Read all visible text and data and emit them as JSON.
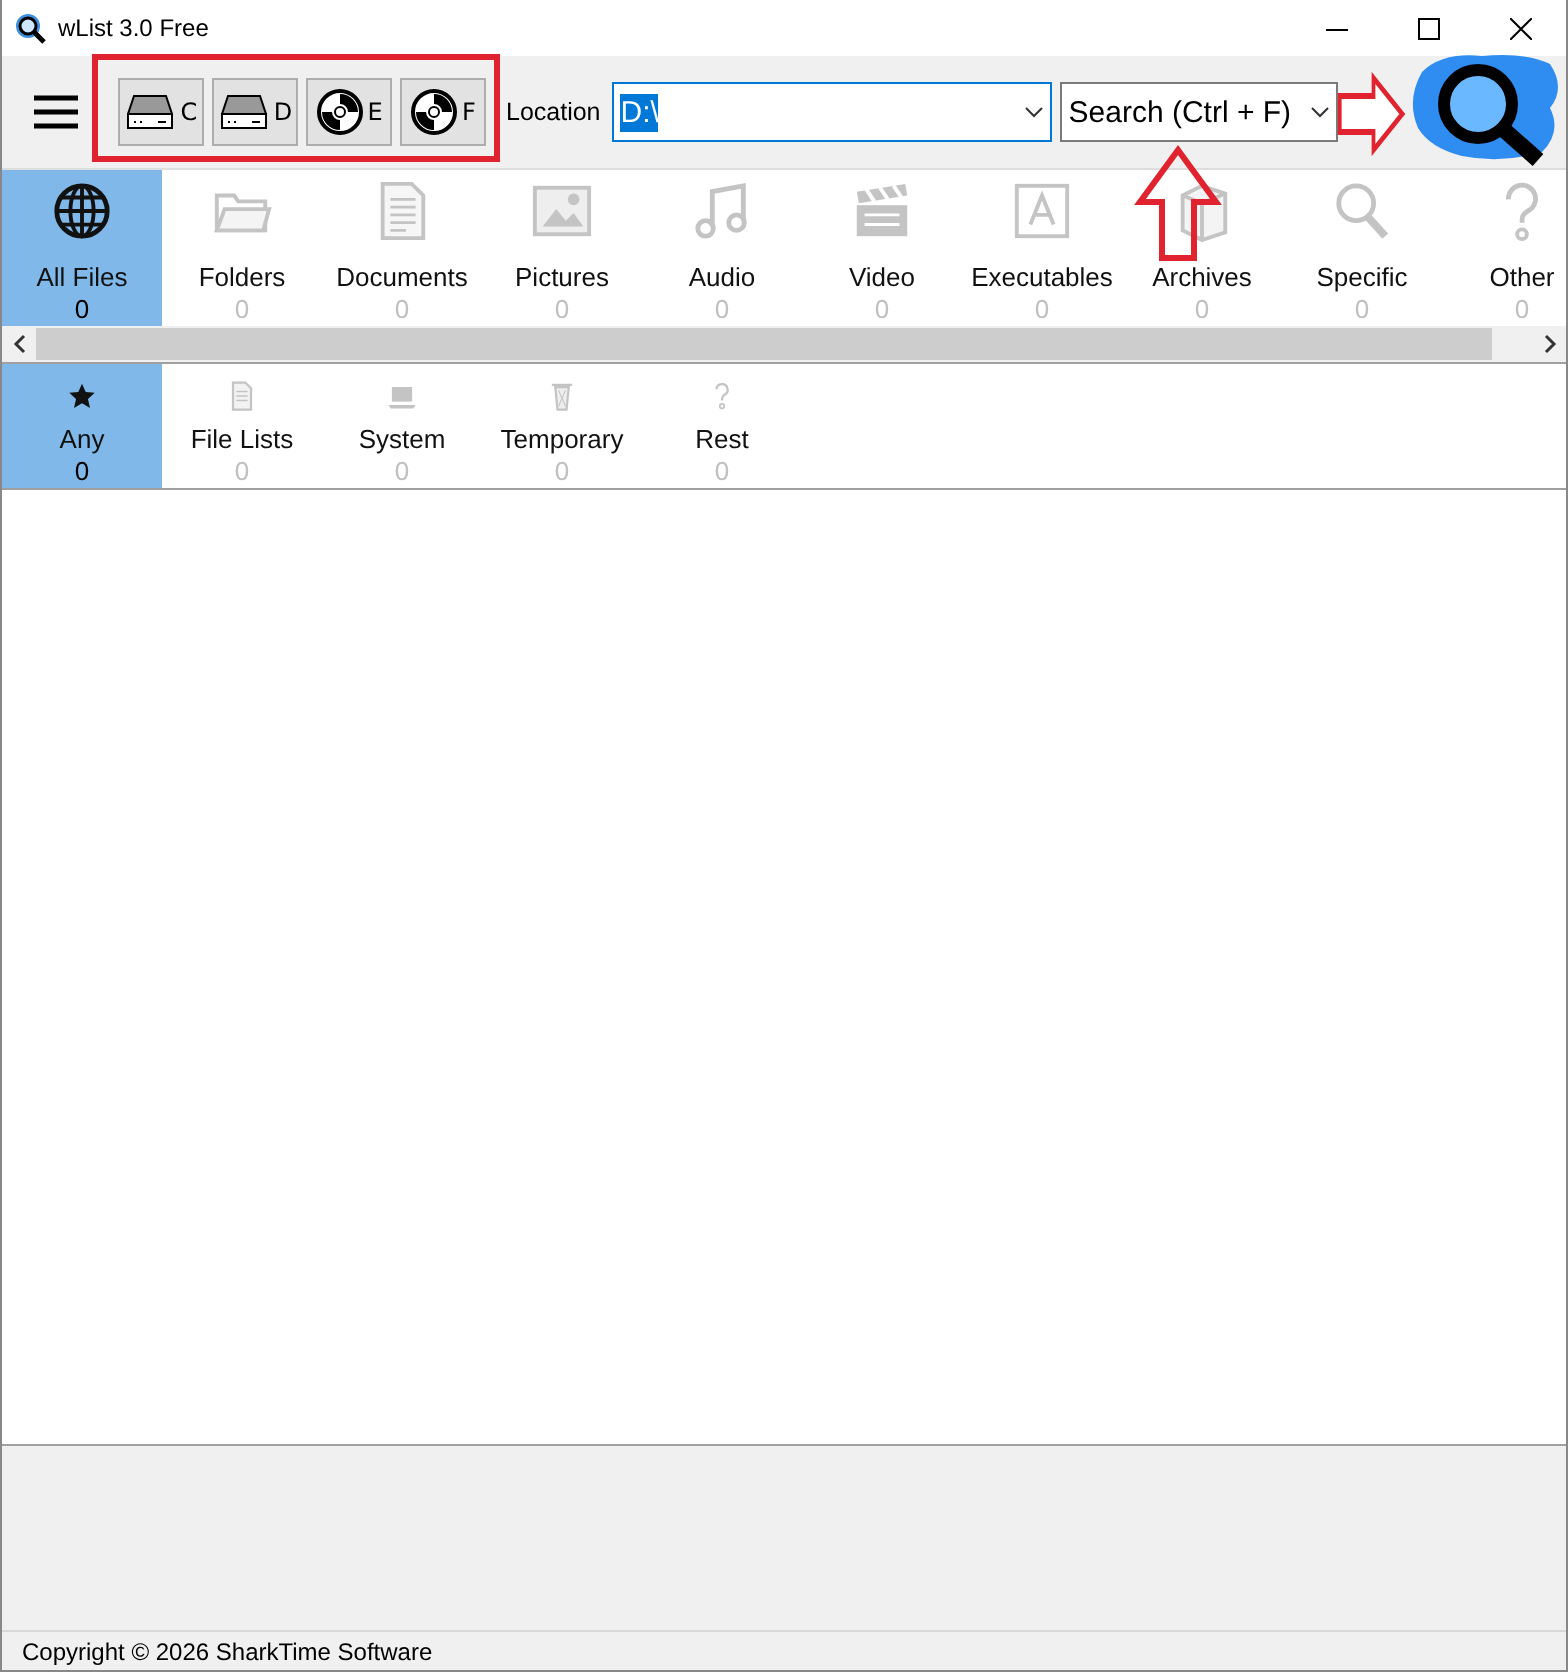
{
  "window": {
    "title": "wList 3.0 Free"
  },
  "toolbar": {
    "drives": [
      {
        "letter": "C",
        "kind": "hdd"
      },
      {
        "letter": "D",
        "kind": "hdd"
      },
      {
        "letter": "E",
        "kind": "disc"
      },
      {
        "letter": "F",
        "kind": "disc"
      }
    ],
    "location_label": "Location",
    "location": {
      "value": "D:\\"
    },
    "search": {
      "value": "Search (Ctrl + F)"
    }
  },
  "categories": [
    {
      "label": "All Files",
      "count": "0",
      "selected": true
    },
    {
      "label": "Folders",
      "count": "0",
      "selected": false
    },
    {
      "label": "Documents",
      "count": "0",
      "selected": false
    },
    {
      "label": "Pictures",
      "count": "0",
      "selected": false
    },
    {
      "label": "Audio",
      "count": "0",
      "selected": false
    },
    {
      "label": "Video",
      "count": "0",
      "selected": false
    },
    {
      "label": "Executables",
      "count": "0",
      "selected": false
    },
    {
      "label": "Archives",
      "count": "0",
      "selected": false
    },
    {
      "label": "Specific",
      "count": "0",
      "selected": false
    },
    {
      "label": "Other",
      "count": "0",
      "selected": false
    }
  ],
  "subcategories": [
    {
      "label": "Any",
      "count": "0",
      "selected": true
    },
    {
      "label": "File Lists",
      "count": "0",
      "selected": false
    },
    {
      "label": "System",
      "count": "0",
      "selected": false
    },
    {
      "label": "Temporary",
      "count": "0",
      "selected": false
    },
    {
      "label": "Rest",
      "count": "0",
      "selected": false
    }
  ],
  "status_bar": "Copyright © 2026 SharkTime Software"
}
